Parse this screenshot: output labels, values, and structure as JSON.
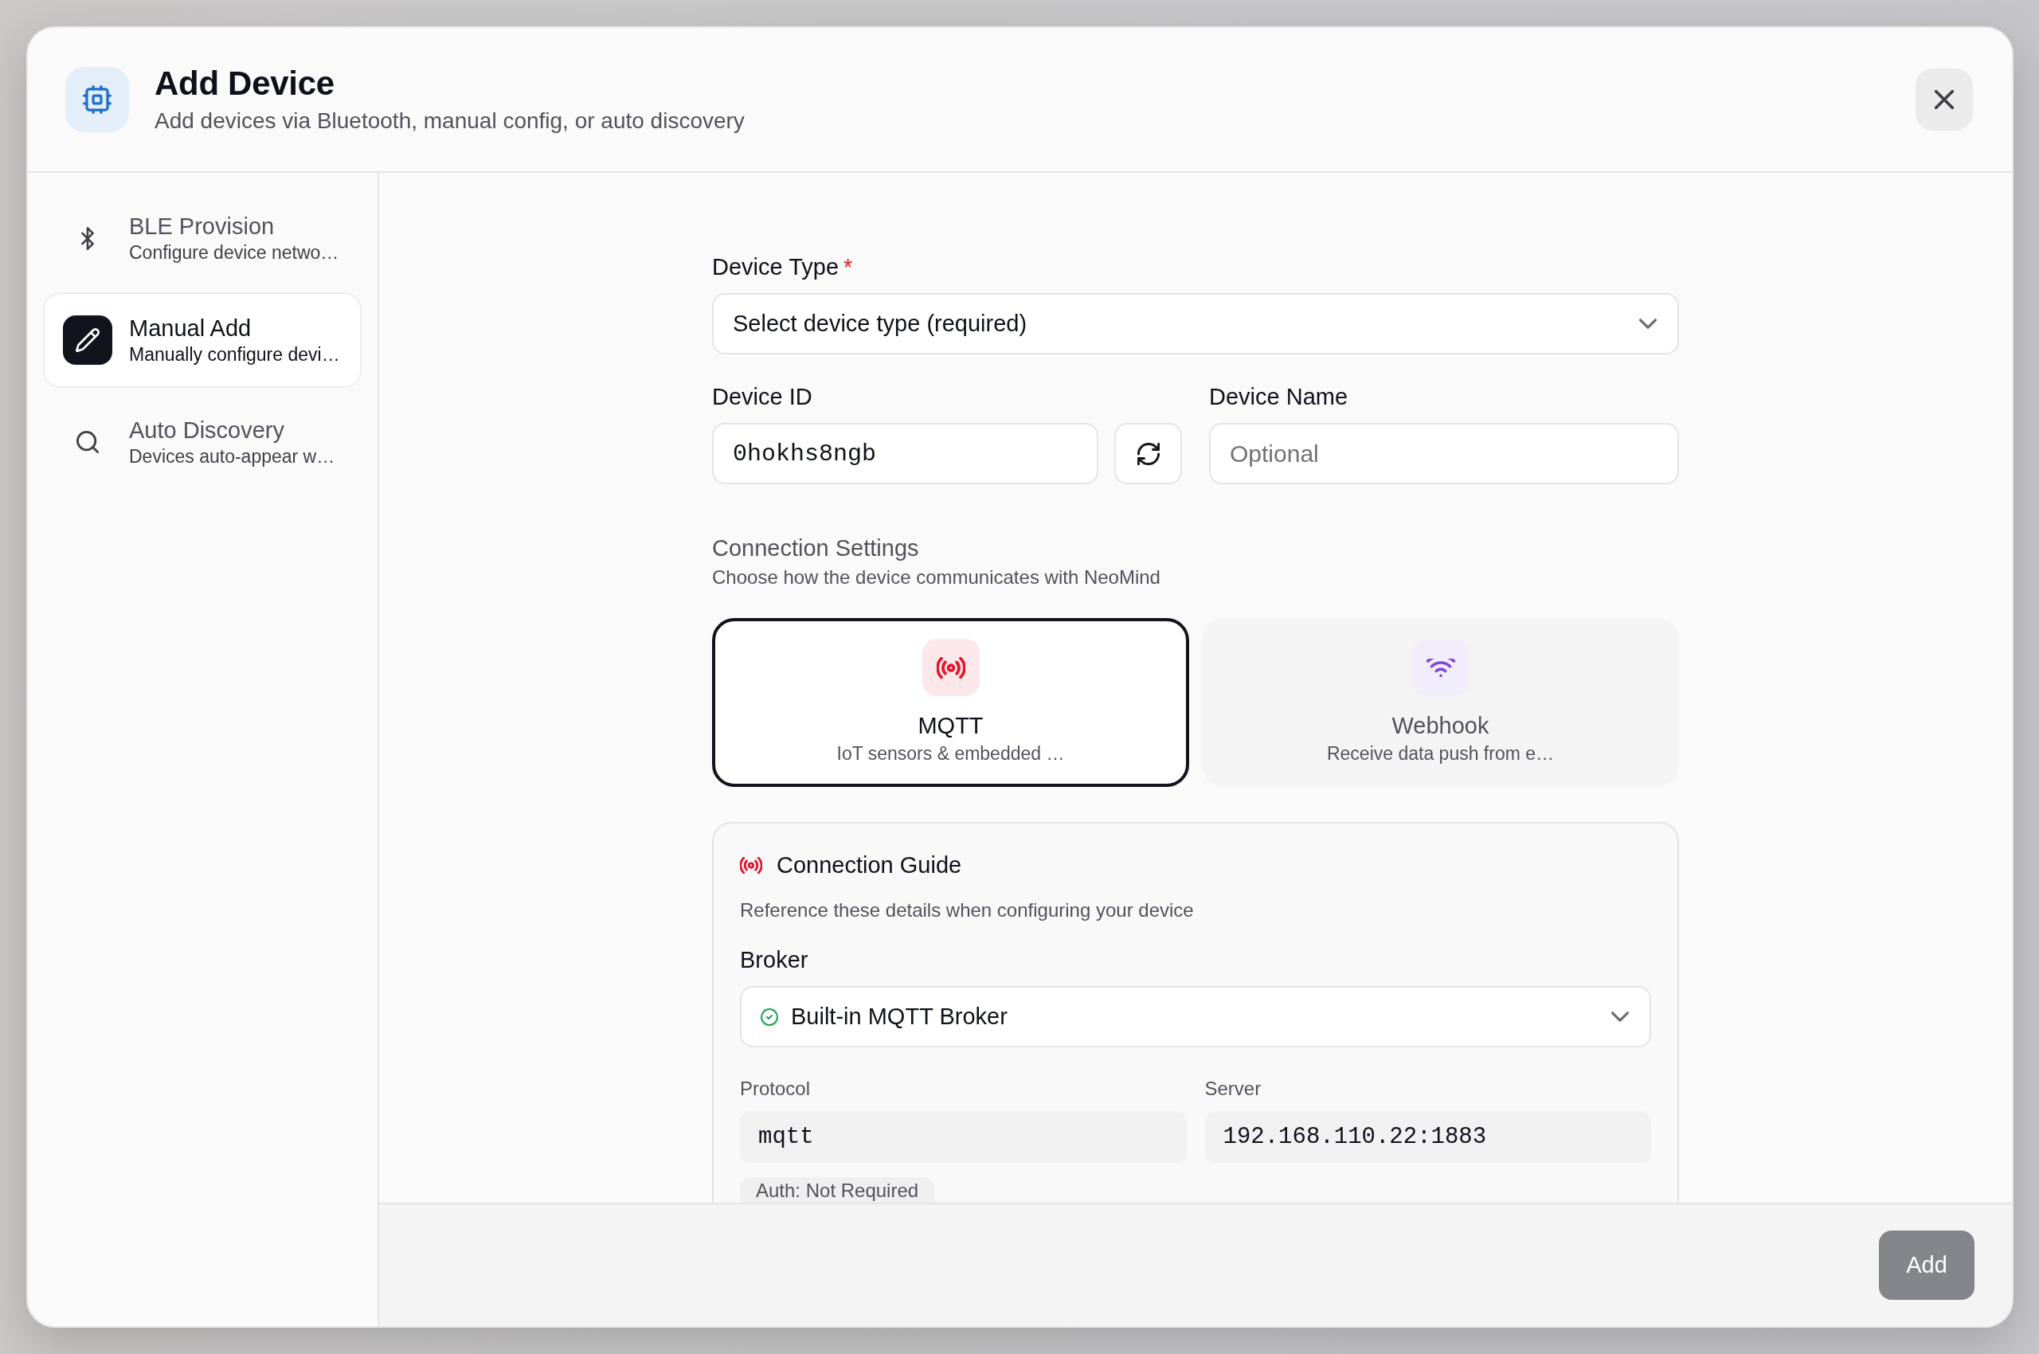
{
  "dialog": {
    "title": "Add Device",
    "subtitle": "Add devices via Bluetooth, manual config, or auto discovery"
  },
  "sidebar": {
    "items": [
      {
        "title": "BLE Provision",
        "description": "Configure device netwo…",
        "selected": false
      },
      {
        "title": "Manual Add",
        "description": "Manually configure devi…",
        "selected": true
      },
      {
        "title": "Auto Discovery",
        "description": "Devices auto-appear w…",
        "selected": false
      }
    ]
  },
  "form": {
    "device_type": {
      "label": "Device Type",
      "required_mark": "*",
      "placeholder": "Select device type (required)"
    },
    "device_id": {
      "label": "Device ID",
      "value": "0hokhs8ngb"
    },
    "device_name": {
      "label": "Device Name",
      "placeholder": "Optional"
    },
    "connection_settings": {
      "title": "Connection Settings",
      "description": "Choose how the device communicates with NeoMind",
      "options": [
        {
          "name": "MQTT",
          "description": "IoT sensors & embedded …",
          "selected": true,
          "color": "#e0162b"
        },
        {
          "name": "Webhook",
          "description": "Receive data push from e…",
          "selected": false,
          "color": "#7f47cf"
        }
      ]
    },
    "connection_guide": {
      "title": "Connection Guide",
      "description": "Reference these details when configuring your device",
      "broker": {
        "label": "Broker",
        "value": "Built-in MQTT Broker"
      },
      "protocol": {
        "label": "Protocol",
        "value": "mqtt"
      },
      "server": {
        "label": "Server",
        "value": "192.168.110.22:1883"
      },
      "auth": "Auth: Not Required"
    }
  },
  "footer": {
    "add_button": "Add"
  }
}
